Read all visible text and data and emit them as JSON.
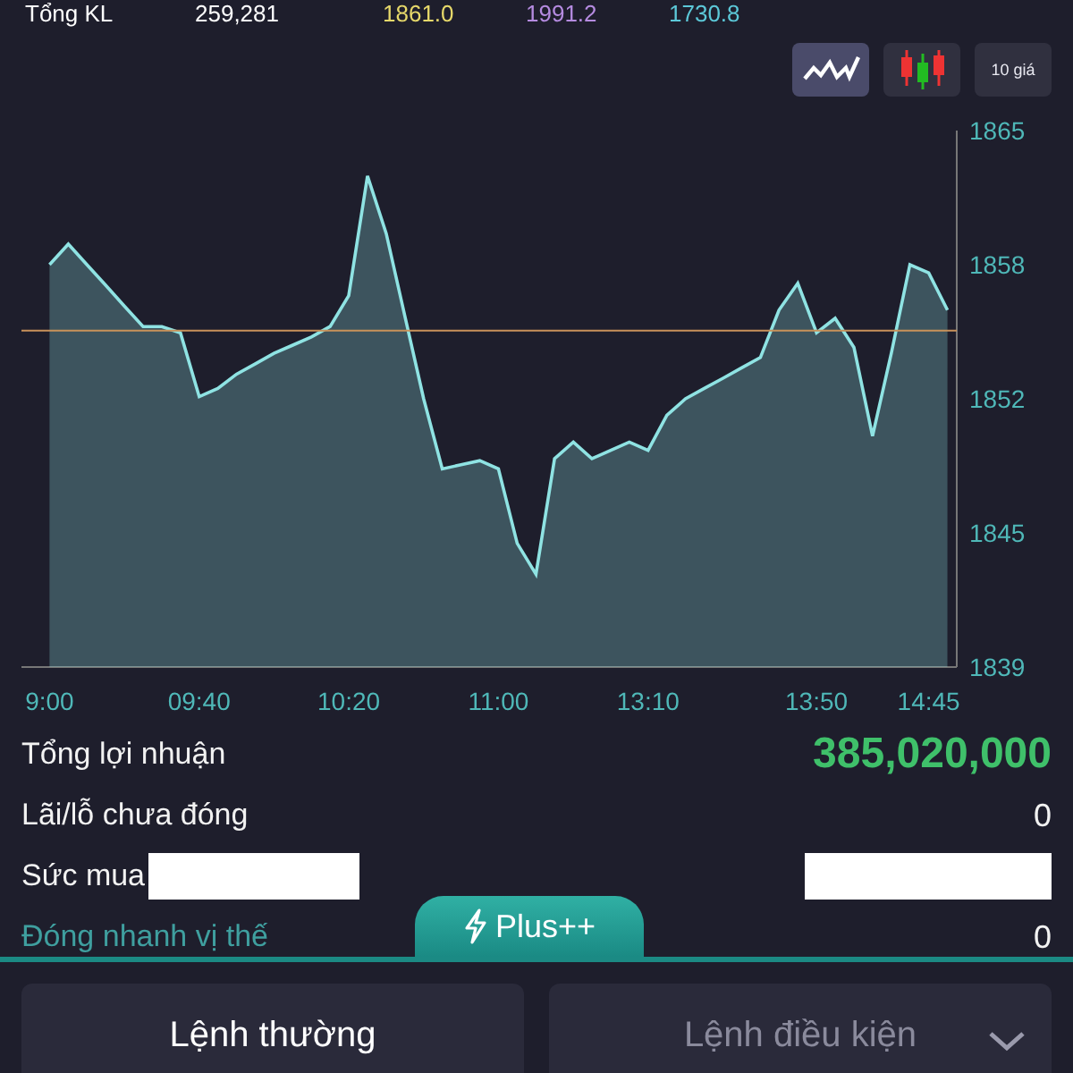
{
  "summary": {
    "label": "Tổng KL",
    "volume": "259,281",
    "prices": [
      {
        "text": "1861.0",
        "color": "#e6d86a"
      },
      {
        "text": "1991.2",
        "color": "#b58be0"
      },
      {
        "text": "1730.8",
        "color": "#5cc8d8"
      }
    ]
  },
  "chart_modes": [
    {
      "kind": "line",
      "selected": true
    },
    {
      "kind": "candles",
      "selected": false
    },
    {
      "kind": "text",
      "label": "10 giá",
      "selected": false
    }
  ],
  "chart": {
    "chart_data": {
      "type": "area",
      "categories": [
        null,
        "9:00",
        null,
        null,
        null,
        null,
        null,
        null,
        null,
        "09:40",
        null,
        null,
        null,
        null,
        null,
        null,
        null,
        "10:20",
        null,
        null,
        null,
        null,
        null,
        null,
        null,
        "11:00",
        null,
        null,
        null,
        null,
        null,
        null,
        null,
        "13:10",
        null,
        null,
        null,
        null,
        null,
        null,
        null,
        null,
        "13:50",
        null,
        null,
        null,
        null,
        null,
        "14:45",
        null
      ],
      "series": [
        {
          "color": "#8fe3e3",
          "values": [
            null,
            1858.5,
            1859.5,
            1858.5,
            1857.5,
            1856.5,
            1855.5,
            1855.5,
            1855.2,
            1852.1,
            1852.5,
            1853.2,
            1853.7,
            1854.2,
            1854.6,
            1855.0,
            1855.5,
            1857.0,
            1862.8,
            1860.0,
            1856.0,
            1852.0,
            1848.6,
            1848.8,
            1849.0,
            1848.6,
            1845.0,
            1843.5,
            1849.1,
            1849.9,
            1849.1,
            1849.5,
            1849.9,
            1849.5,
            1851.2,
            1852.0,
            1852.5,
            1853.0,
            1853.5,
            1854.0,
            1856.3,
            1857.6,
            1855.2,
            1855.9,
            1854.5,
            1850.2,
            1854.2,
            1858.5,
            1858.1,
            1856.3
          ]
        }
      ],
      "ylim": [
        1839,
        1865
      ],
      "yticks": [
        1839,
        {
          "value": 1845.5,
          "label": "1845"
        },
        1852,
        {
          "value": 1858.5,
          "label": "1858"
        },
        1865
      ],
      "ref_lines": [
        {
          "axis": "y",
          "value": 1855.3,
          "color": "#c9925a"
        }
      ]
    }
  },
  "stats": [
    {
      "kind": "total",
      "label": "Tổng lợi nhuận",
      "value": "385,020,000"
    },
    {
      "kind": "plain",
      "label": "Lãi/lỗ chưa đóng",
      "value": "0"
    },
    {
      "kind": "redacted",
      "label": "Sức mua"
    },
    {
      "kind": "link",
      "label": "Đóng nhanh vị thế",
      "value": "0"
    }
  ],
  "plus_tab": {
    "label": "Plus++"
  },
  "order_tabs": [
    {
      "label": "Lệnh thường",
      "selected": true,
      "dropdown": false
    },
    {
      "label": "Lệnh điều kiện",
      "selected": false,
      "dropdown": true
    }
  ]
}
